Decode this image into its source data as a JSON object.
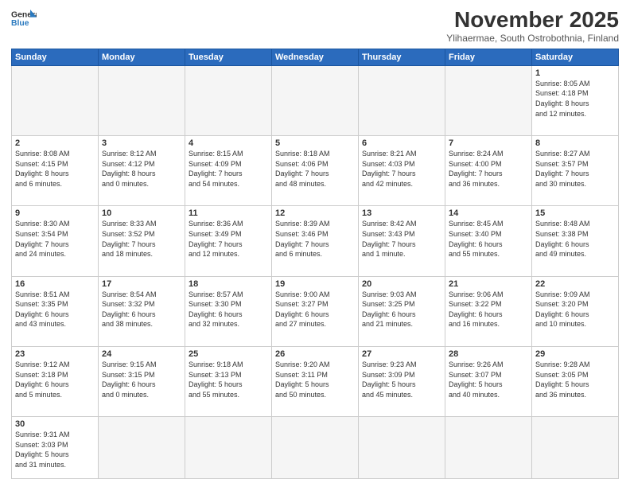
{
  "header": {
    "logo_general": "General",
    "logo_blue": "Blue",
    "month_title": "November 2025",
    "location": "Ylihaermae, South Ostrobothnia, Finland"
  },
  "weekdays": [
    "Sunday",
    "Monday",
    "Tuesday",
    "Wednesday",
    "Thursday",
    "Friday",
    "Saturday"
  ],
  "weeks": [
    [
      {
        "day": "",
        "info": ""
      },
      {
        "day": "",
        "info": ""
      },
      {
        "day": "",
        "info": ""
      },
      {
        "day": "",
        "info": ""
      },
      {
        "day": "",
        "info": ""
      },
      {
        "day": "",
        "info": ""
      },
      {
        "day": "1",
        "info": "Sunrise: 8:05 AM\nSunset: 4:18 PM\nDaylight: 8 hours\nand 12 minutes."
      }
    ],
    [
      {
        "day": "2",
        "info": "Sunrise: 8:08 AM\nSunset: 4:15 PM\nDaylight: 8 hours\nand 6 minutes."
      },
      {
        "day": "3",
        "info": "Sunrise: 8:12 AM\nSunset: 4:12 PM\nDaylight: 8 hours\nand 0 minutes."
      },
      {
        "day": "4",
        "info": "Sunrise: 8:15 AM\nSunset: 4:09 PM\nDaylight: 7 hours\nand 54 minutes."
      },
      {
        "day": "5",
        "info": "Sunrise: 8:18 AM\nSunset: 4:06 PM\nDaylight: 7 hours\nand 48 minutes."
      },
      {
        "day": "6",
        "info": "Sunrise: 8:21 AM\nSunset: 4:03 PM\nDaylight: 7 hours\nand 42 minutes."
      },
      {
        "day": "7",
        "info": "Sunrise: 8:24 AM\nSunset: 4:00 PM\nDaylight: 7 hours\nand 36 minutes."
      },
      {
        "day": "8",
        "info": "Sunrise: 8:27 AM\nSunset: 3:57 PM\nDaylight: 7 hours\nand 30 minutes."
      }
    ],
    [
      {
        "day": "9",
        "info": "Sunrise: 8:30 AM\nSunset: 3:54 PM\nDaylight: 7 hours\nand 24 minutes."
      },
      {
        "day": "10",
        "info": "Sunrise: 8:33 AM\nSunset: 3:52 PM\nDaylight: 7 hours\nand 18 minutes."
      },
      {
        "day": "11",
        "info": "Sunrise: 8:36 AM\nSunset: 3:49 PM\nDaylight: 7 hours\nand 12 minutes."
      },
      {
        "day": "12",
        "info": "Sunrise: 8:39 AM\nSunset: 3:46 PM\nDaylight: 7 hours\nand 6 minutes."
      },
      {
        "day": "13",
        "info": "Sunrise: 8:42 AM\nSunset: 3:43 PM\nDaylight: 7 hours\nand 1 minute."
      },
      {
        "day": "14",
        "info": "Sunrise: 8:45 AM\nSunset: 3:40 PM\nDaylight: 6 hours\nand 55 minutes."
      },
      {
        "day": "15",
        "info": "Sunrise: 8:48 AM\nSunset: 3:38 PM\nDaylight: 6 hours\nand 49 minutes."
      }
    ],
    [
      {
        "day": "16",
        "info": "Sunrise: 8:51 AM\nSunset: 3:35 PM\nDaylight: 6 hours\nand 43 minutes."
      },
      {
        "day": "17",
        "info": "Sunrise: 8:54 AM\nSunset: 3:32 PM\nDaylight: 6 hours\nand 38 minutes."
      },
      {
        "day": "18",
        "info": "Sunrise: 8:57 AM\nSunset: 3:30 PM\nDaylight: 6 hours\nand 32 minutes."
      },
      {
        "day": "19",
        "info": "Sunrise: 9:00 AM\nSunset: 3:27 PM\nDaylight: 6 hours\nand 27 minutes."
      },
      {
        "day": "20",
        "info": "Sunrise: 9:03 AM\nSunset: 3:25 PM\nDaylight: 6 hours\nand 21 minutes."
      },
      {
        "day": "21",
        "info": "Sunrise: 9:06 AM\nSunset: 3:22 PM\nDaylight: 6 hours\nand 16 minutes."
      },
      {
        "day": "22",
        "info": "Sunrise: 9:09 AM\nSunset: 3:20 PM\nDaylight: 6 hours\nand 10 minutes."
      }
    ],
    [
      {
        "day": "23",
        "info": "Sunrise: 9:12 AM\nSunset: 3:18 PM\nDaylight: 6 hours\nand 5 minutes."
      },
      {
        "day": "24",
        "info": "Sunrise: 9:15 AM\nSunset: 3:15 PM\nDaylight: 6 hours\nand 0 minutes."
      },
      {
        "day": "25",
        "info": "Sunrise: 9:18 AM\nSunset: 3:13 PM\nDaylight: 5 hours\nand 55 minutes."
      },
      {
        "day": "26",
        "info": "Sunrise: 9:20 AM\nSunset: 3:11 PM\nDaylight: 5 hours\nand 50 minutes."
      },
      {
        "day": "27",
        "info": "Sunrise: 9:23 AM\nSunset: 3:09 PM\nDaylight: 5 hours\nand 45 minutes."
      },
      {
        "day": "28",
        "info": "Sunrise: 9:26 AM\nSunset: 3:07 PM\nDaylight: 5 hours\nand 40 minutes."
      },
      {
        "day": "29",
        "info": "Sunrise: 9:28 AM\nSunset: 3:05 PM\nDaylight: 5 hours\nand 36 minutes."
      }
    ],
    [
      {
        "day": "30",
        "info": "Sunrise: 9:31 AM\nSunset: 3:03 PM\nDaylight: 5 hours\nand 31 minutes."
      },
      {
        "day": "",
        "info": ""
      },
      {
        "day": "",
        "info": ""
      },
      {
        "day": "",
        "info": ""
      },
      {
        "day": "",
        "info": ""
      },
      {
        "day": "",
        "info": ""
      },
      {
        "day": "",
        "info": ""
      }
    ]
  ]
}
